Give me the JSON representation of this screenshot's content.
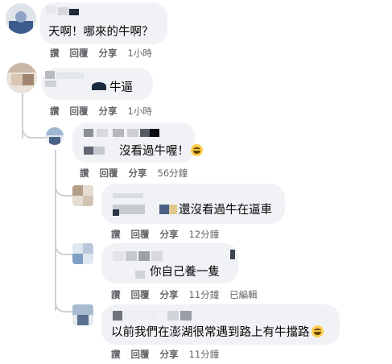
{
  "comments": [
    {
      "text": "天啊！哪來的牛啊？",
      "actions": [
        "讚",
        "回覆",
        "分享"
      ],
      "time": "1小時"
    },
    {
      "text": "牛逼",
      "actions": [
        "讚",
        "回覆",
        "分享"
      ],
      "time": "1小時"
    },
    {
      "text": "沒看過牛喔！",
      "actions": [
        "讚",
        "回覆",
        "分享"
      ],
      "time": "56分鐘",
      "emoji": "laughing-emoji"
    },
    {
      "text": "還沒看過牛在逼車",
      "actions": [
        "讚",
        "回覆",
        "分享"
      ],
      "time": "12分鐘"
    },
    {
      "text": "你自己養一隻",
      "actions": [
        "讚",
        "回覆",
        "分享"
      ],
      "time": "11分鐘",
      "edited": "已編輯"
    },
    {
      "text": "以前我們在澎湖很常遇到路上有牛擋路",
      "actions": [
        "讚",
        "回覆",
        "分享"
      ],
      "time": "11分鐘",
      "emoji": "laughing-emoji"
    }
  ]
}
